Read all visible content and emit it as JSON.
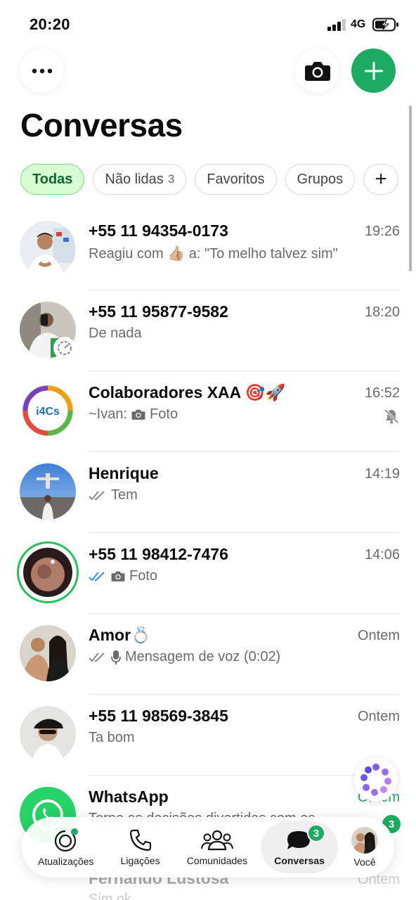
{
  "status_bar": {
    "time": "20:20",
    "network": "4G"
  },
  "header": {
    "title": "Conversas",
    "menu_icon": "ellipsis-icon",
    "camera_icon": "camera-icon",
    "new_chat_icon": "plus-icon"
  },
  "filters": [
    {
      "label": "Todas",
      "count": "",
      "active": true
    },
    {
      "label": "Não lidas",
      "count": "3",
      "active": false
    },
    {
      "label": "Favoritos",
      "count": "",
      "active": false
    },
    {
      "label": "Grupos",
      "count": "",
      "active": false
    }
  ],
  "filters_add": "+",
  "chats": [
    {
      "name": "+55 11 94354-0173",
      "time": "19:26",
      "preview": "Reagiu com 👍🏼 a: \"To melho talvez sim\""
    },
    {
      "name": "+55 11 95877-9582",
      "time": "18:20",
      "preview": "De nada"
    },
    {
      "name": "Colaboradores XAA 🎯🚀",
      "time": "16:52",
      "sender": "~Ivan:",
      "preview": "Foto",
      "avatar_text": "i4Cs"
    },
    {
      "name": "Henrique",
      "time": "14:19",
      "preview": "Tem"
    },
    {
      "name": "+55 11 98412-7476",
      "time": "14:06",
      "preview": "Foto"
    },
    {
      "name": "Amor💍",
      "time": "Ontem",
      "preview": "Mensagem de voz (0:02)"
    },
    {
      "name": "+55 11 98569-3845",
      "time": "Ontem",
      "preview": "Ta bom"
    },
    {
      "name": "WhatsApp",
      "time": "Ontem",
      "unread": "3",
      "preview": "Torne as decisões divertidas com as"
    }
  ],
  "behind_row": {
    "name": "Fernando Lustosa",
    "time": "Ontem",
    "preview": "Sim ok"
  },
  "tabs": [
    {
      "label": "Atualizações",
      "icon": "updates-icon"
    },
    {
      "label": "Ligações",
      "icon": "phone-icon"
    },
    {
      "label": "Comunidades",
      "icon": "communities-icon"
    },
    {
      "label": "Conversas",
      "icon": "chats-icon",
      "badge": "3",
      "active": true
    },
    {
      "label": "Você",
      "icon": "profile-avatar"
    }
  ],
  "colors": {
    "accent": "#1daa61",
    "chip_active_bg": "#d8fdd2",
    "read_ticks": "#2f8df5",
    "muted_text": "#6b6b6b"
  }
}
